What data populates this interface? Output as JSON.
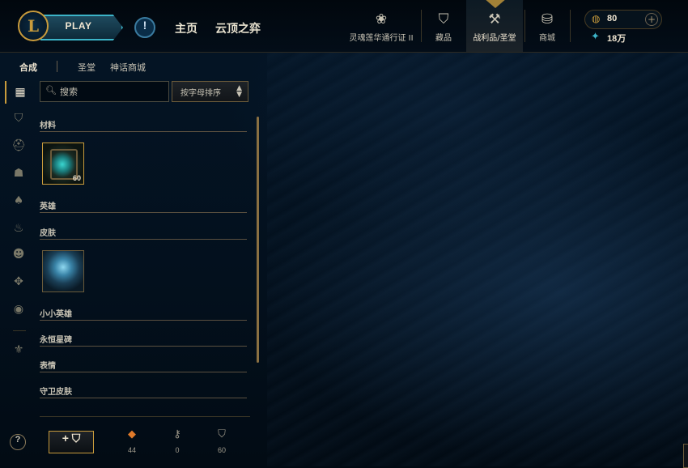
{
  "header": {
    "play_label": "PLAY",
    "nav_main": [
      "主页",
      "云顶之弈"
    ],
    "tabs": [
      {
        "label": "灵魂莲华通行证 II",
        "icon": "lotus-icon"
      },
      {
        "label": "藏品",
        "icon": "collection-icon"
      },
      {
        "label": "战利品/圣堂",
        "icon": "loot-icon",
        "active": true
      },
      {
        "label": "商城",
        "icon": "store-icon"
      }
    ],
    "rp_amount": "80",
    "be_amount": "18万"
  },
  "subnav": {
    "items": [
      "合成",
      "圣堂",
      "神话商城"
    ],
    "active": "合成"
  },
  "controls": {
    "search_placeholder": "搜索",
    "sort_label": "按字母排序"
  },
  "categories": [
    {
      "label": "材料",
      "items": [
        {
          "name": "chest",
          "count": "60"
        }
      ]
    },
    {
      "label": "英雄",
      "items": []
    },
    {
      "label": "皮肤",
      "items": [
        {
          "name": "skin-shard"
        }
      ]
    },
    {
      "label": "小小英雄",
      "items": []
    },
    {
      "label": "永恒星碑",
      "items": []
    },
    {
      "label": "表情",
      "items": []
    },
    {
      "label": "守卫皮肤",
      "items": []
    }
  ],
  "bottom": {
    "help": "?",
    "add_button": "+ ⛉",
    "stats": [
      {
        "icon": "orange-essence-icon",
        "value": "44",
        "color": "#e07a2a"
      },
      {
        "icon": "key-icon",
        "value": "0",
        "color": "#a09b8c"
      },
      {
        "icon": "chest-icon",
        "value": "60",
        "color": "#a09b8c"
      }
    ]
  },
  "colors": {
    "gold": "#c89b3c",
    "blue": "#3cb4c8",
    "text": "#c8c3b4",
    "bg": "#010a13"
  }
}
